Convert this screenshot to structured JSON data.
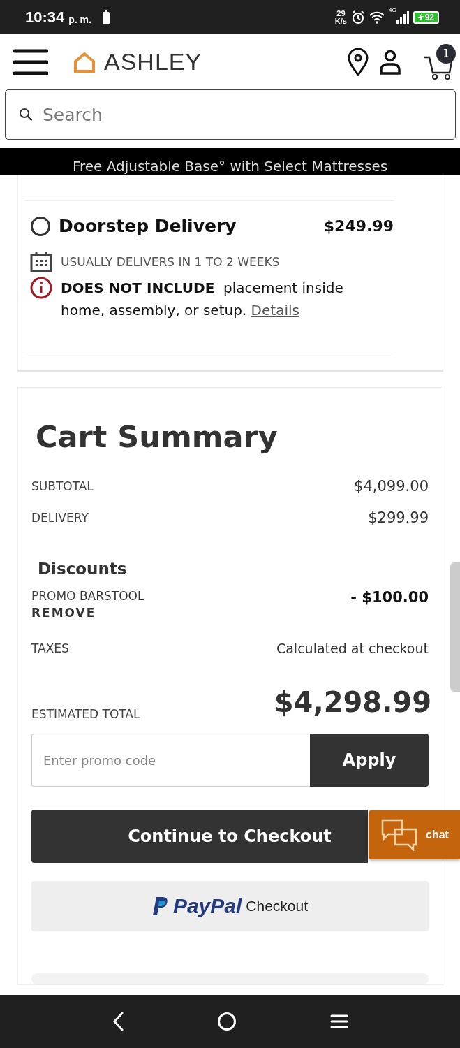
{
  "status_bar": {
    "time": "10:34",
    "ampm": "p. m.",
    "speed": "29",
    "speed_unit": "K/s",
    "network": "4G",
    "battery": "92"
  },
  "header": {
    "logo": "ASHLEY",
    "cart_count": "1"
  },
  "search": {
    "placeholder": "Search"
  },
  "promo_banner": "Free Adjustable Base° with Select Mattresses",
  "delivery_option": {
    "name": "Doorstep Delivery",
    "price": "$249.99",
    "selected": false,
    "eta": "USUALLY DELIVERS IN 1 TO 2 WEEKS",
    "notice_bold": "DOES NOT INCLUDE",
    "notice": "placement inside home, assembly, or setup.",
    "link": "Details"
  },
  "cart_summary": {
    "title": "Cart Summary",
    "lines": [
      {
        "label": "SUBTOTAL",
        "value": "$4,099.00"
      },
      {
        "label": "DELIVERY",
        "value": "$299.99"
      }
    ],
    "discounts_title": "Discounts",
    "discount": {
      "label": "PROMO",
      "code": "BARSTOOL",
      "action": "REMOVE",
      "value": "- $100.00"
    },
    "taxes": {
      "label": "TAXES",
      "value": "Calculated at checkout"
    },
    "total": {
      "label": "ESTIMATED TOTAL",
      "value": "$4,298.99"
    },
    "promo_field": {
      "placeholder": "Enter promo code"
    },
    "apply_button": "Apply",
    "checkout_button": "Continue to Checkout",
    "paypal": {
      "brand": "PayPal",
      "label": "Checkout"
    }
  },
  "chat": "chat"
}
